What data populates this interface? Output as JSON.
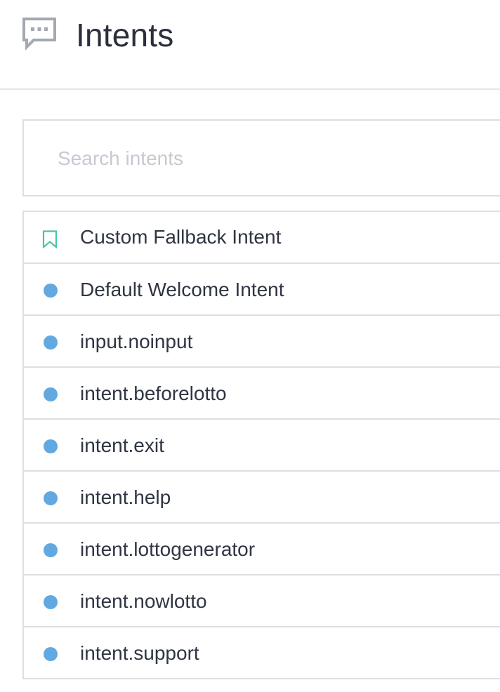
{
  "header": {
    "icon": "chat-bubble-icon",
    "title": "Intents"
  },
  "search": {
    "placeholder": "Search intents",
    "value": ""
  },
  "colors": {
    "dot_blue": "#62a9e2",
    "bookmark_green": "#4dc4a0",
    "header_icon_gray": "#a3a8b1",
    "border": "#dcdfe3",
    "text": "#2f3542",
    "placeholder": "#c6cad1"
  },
  "intents": [
    {
      "label": "Custom Fallback Intent",
      "icon": "bookmark-icon"
    },
    {
      "label": "Default Welcome Intent",
      "icon": "dot-icon"
    },
    {
      "label": "input.noinput",
      "icon": "dot-icon"
    },
    {
      "label": "intent.beforelotto",
      "icon": "dot-icon"
    },
    {
      "label": "intent.exit",
      "icon": "dot-icon"
    },
    {
      "label": "intent.help",
      "icon": "dot-icon"
    },
    {
      "label": "intent.lottogenerator",
      "icon": "dot-icon"
    },
    {
      "label": "intent.nowlotto",
      "icon": "dot-icon"
    },
    {
      "label": "intent.support",
      "icon": "dot-icon"
    }
  ]
}
